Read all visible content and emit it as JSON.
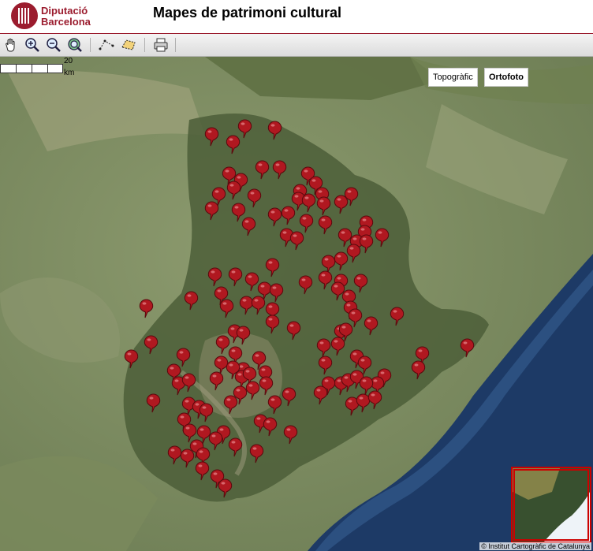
{
  "brand": {
    "line1": "Diputació",
    "line2": "Barcelona",
    "color": "#9b1c2e"
  },
  "page_title": "Mapes de patrimoni cultural",
  "toolbar": {
    "tools": [
      {
        "name": "pan-hand-icon"
      },
      {
        "name": "zoom-in-icon"
      },
      {
        "name": "zoom-out-icon"
      },
      {
        "name": "zoom-extent-icon"
      },
      {
        "name": "measure-distance-icon"
      },
      {
        "name": "measure-area-icon"
      },
      {
        "name": "print-icon"
      }
    ]
  },
  "scale": {
    "value": "20",
    "unit": "km"
  },
  "layers": {
    "topographic": "Topogràfic",
    "orthophoto": "Ortofoto",
    "active": "orthophoto"
  },
  "copyright": "© Institut Cartogràfic de Catalunya",
  "colors": {
    "marker": "#b01820",
    "sea": "#1d3a66",
    "land": "#7d8c61"
  },
  "markers": [
    [
      268,
      172
    ],
    [
      310,
      162
    ],
    [
      348,
      164
    ],
    [
      295,
      182
    ],
    [
      332,
      214
    ],
    [
      354,
      214
    ],
    [
      290,
      222
    ],
    [
      305,
      230
    ],
    [
      296,
      240
    ],
    [
      277,
      248
    ],
    [
      390,
      222
    ],
    [
      400,
      234
    ],
    [
      380,
      244
    ],
    [
      408,
      248
    ],
    [
      445,
      248
    ],
    [
      322,
      250
    ],
    [
      268,
      266
    ],
    [
      302,
      268
    ],
    [
      378,
      254
    ],
    [
      391,
      256
    ],
    [
      410,
      260
    ],
    [
      432,
      258
    ],
    [
      348,
      274
    ],
    [
      365,
      272
    ],
    [
      388,
      282
    ],
    [
      412,
      284
    ],
    [
      315,
      286
    ],
    [
      464,
      284
    ],
    [
      462,
      296
    ],
    [
      484,
      300
    ],
    [
      363,
      300
    ],
    [
      376,
      304
    ],
    [
      437,
      300
    ],
    [
      452,
      308
    ],
    [
      464,
      308
    ],
    [
      448,
      320
    ],
    [
      416,
      334
    ],
    [
      432,
      330
    ],
    [
      345,
      338
    ],
    [
      272,
      350
    ],
    [
      298,
      350
    ],
    [
      319,
      356
    ],
    [
      335,
      368
    ],
    [
      350,
      370
    ],
    [
      387,
      360
    ],
    [
      412,
      354
    ],
    [
      432,
      358
    ],
    [
      457,
      358
    ],
    [
      242,
      380
    ],
    [
      280,
      374
    ],
    [
      287,
      390
    ],
    [
      312,
      386
    ],
    [
      327,
      386
    ],
    [
      345,
      394
    ],
    [
      428,
      368
    ],
    [
      442,
      378
    ],
    [
      444,
      392
    ],
    [
      450,
      402
    ],
    [
      470,
      412
    ],
    [
      503,
      400
    ],
    [
      185,
      390
    ],
    [
      345,
      410
    ],
    [
      372,
      418
    ],
    [
      297,
      422
    ],
    [
      308,
      424
    ],
    [
      282,
      436
    ],
    [
      432,
      422
    ],
    [
      438,
      420
    ],
    [
      410,
      440
    ],
    [
      428,
      438
    ],
    [
      191,
      436
    ],
    [
      166,
      454
    ],
    [
      232,
      452
    ],
    [
      298,
      450
    ],
    [
      328,
      456
    ],
    [
      280,
      462
    ],
    [
      452,
      454
    ],
    [
      462,
      462
    ],
    [
      412,
      462
    ],
    [
      535,
      450
    ],
    [
      592,
      440
    ],
    [
      530,
      468
    ],
    [
      220,
      472
    ],
    [
      308,
      470
    ],
    [
      336,
      474
    ],
    [
      487,
      478
    ],
    [
      226,
      488
    ],
    [
      239,
      484
    ],
    [
      274,
      482
    ],
    [
      295,
      468
    ],
    [
      306,
      480
    ],
    [
      316,
      476
    ],
    [
      337,
      488
    ],
    [
      478,
      488
    ],
    [
      432,
      488
    ],
    [
      441,
      484
    ],
    [
      452,
      480
    ],
    [
      464,
      488
    ],
    [
      416,
      488
    ],
    [
      406,
      500
    ],
    [
      366,
      502
    ],
    [
      320,
      494
    ],
    [
      304,
      500
    ],
    [
      292,
      512
    ],
    [
      348,
      512
    ],
    [
      194,
      510
    ],
    [
      239,
      514
    ],
    [
      252,
      518
    ],
    [
      261,
      522
    ],
    [
      446,
      514
    ],
    [
      460,
      510
    ],
    [
      475,
      506
    ],
    [
      233,
      534
    ],
    [
      330,
      536
    ],
    [
      342,
      540
    ],
    [
      240,
      548
    ],
    [
      258,
      550
    ],
    [
      283,
      550
    ],
    [
      368,
      550
    ],
    [
      273,
      558
    ],
    [
      298,
      566
    ],
    [
      325,
      574
    ],
    [
      221,
      576
    ],
    [
      237,
      580
    ],
    [
      249,
      568
    ],
    [
      257,
      578
    ],
    [
      256,
      596
    ],
    [
      275,
      606
    ],
    [
      285,
      618
    ]
  ]
}
